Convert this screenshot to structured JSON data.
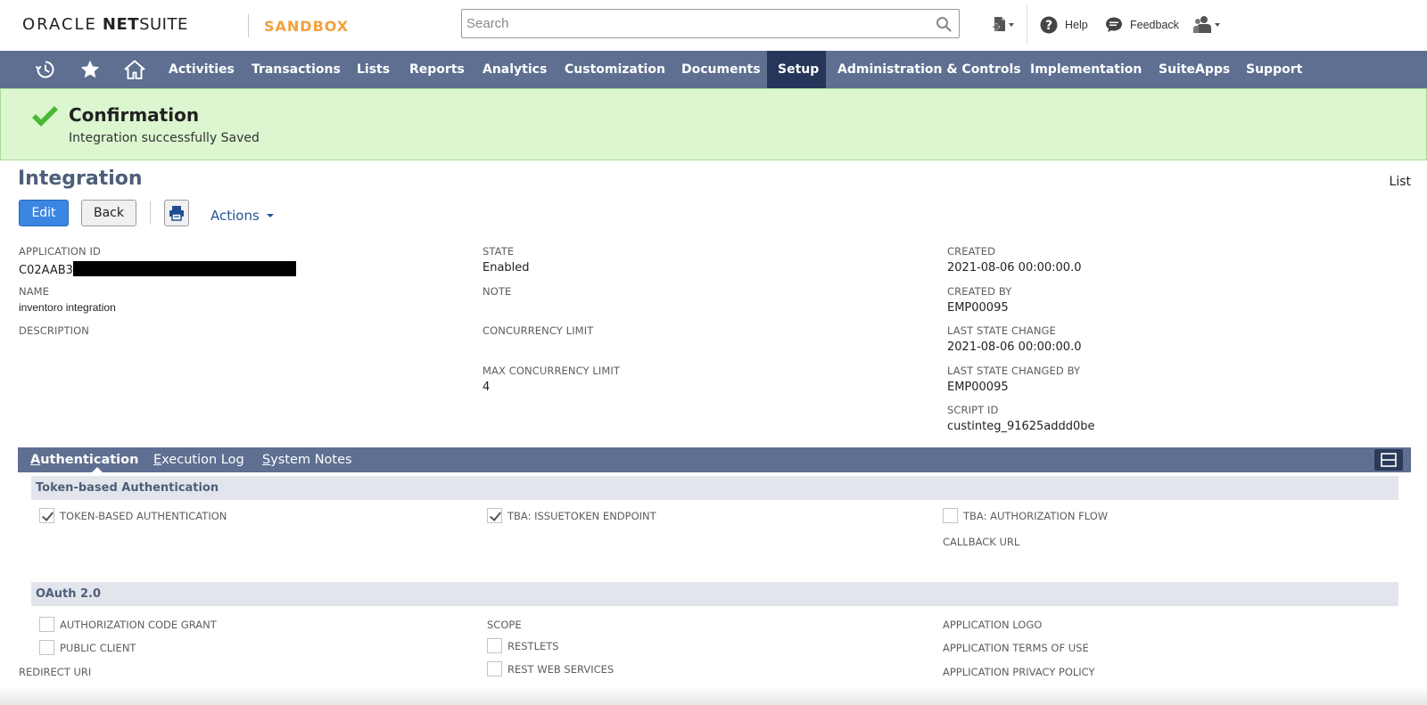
{
  "header": {
    "logo_oracle": "ORACLE",
    "logo_net": "NET",
    "logo_suite": "SUITE",
    "environment": "SANDBOX",
    "search_placeholder": "Search",
    "help_label": "Help",
    "feedback_label": "Feedback"
  },
  "nav": {
    "items": [
      "Activities",
      "Transactions",
      "Lists",
      "Reports",
      "Analytics",
      "Customization",
      "Documents",
      "Setup",
      "Administration & Controls",
      "Implementation",
      "SuiteApps",
      "Support"
    ],
    "active": "Setup",
    "icons": [
      "recent-records-icon",
      "star-icon",
      "home-icon"
    ]
  },
  "confirmation": {
    "title": "Confirmation",
    "message": "Integration successfully Saved",
    "color": "#dcf6cf"
  },
  "page": {
    "title": "Integration",
    "list_link": "List",
    "edit_label": "Edit",
    "back_label": "Back",
    "actions_label": "Actions"
  },
  "fields": {
    "application_id_label": "APPLICATION ID",
    "application_id_value": "C02AAB3",
    "name_label": "NAME",
    "name_value": "inventoro integration",
    "description_label": "DESCRIPTION",
    "state_label": "STATE",
    "state_value": "Enabled",
    "note_label": "NOTE",
    "concurrency_label": "CONCURRENCY LIMIT",
    "max_concurrency_label": "MAX CONCURRENCY LIMIT",
    "max_concurrency_value": "4",
    "created_label": "CREATED",
    "created_value": "2021-08-06 00:00:00.0",
    "created_by_label": "CREATED BY",
    "created_by_value": "EMP00095",
    "last_state_change_label": "LAST STATE CHANGE",
    "last_state_change_value": "2021-08-06 00:00:00.0",
    "last_state_changed_by_label": "LAST STATE CHANGED BY",
    "last_state_changed_by_value": "EMP00095",
    "script_id_label": "SCRIPT ID",
    "script_id_value": "custinteg_91625addd0be"
  },
  "subtabs": {
    "authentication": {
      "first": "A",
      "rest": "uthentication"
    },
    "execution_log": {
      "first": "E",
      "rest": "xecution Log"
    },
    "system_notes": {
      "first": "S",
      "rest": "ystem Notes"
    }
  },
  "tba": {
    "heading": "Token-based Authentication",
    "token_based_auth": {
      "label": "TOKEN-BASED AUTHENTICATION",
      "checked": true
    },
    "issuetoken": {
      "label": "TBA: ISSUETOKEN ENDPOINT",
      "checked": true
    },
    "auth_flow": {
      "label": "TBA: AUTHORIZATION FLOW",
      "checked": false
    },
    "callback_url_label": "CALLBACK URL"
  },
  "oauth": {
    "heading": "OAuth 2.0",
    "auth_code_grant": {
      "label": "AUTHORIZATION CODE GRANT",
      "checked": false
    },
    "public_client": {
      "label": "PUBLIC CLIENT",
      "checked": false
    },
    "redirect_uri_label": "REDIRECT URI",
    "scope_label": "SCOPE",
    "restlets": {
      "label": "RESTLETS",
      "checked": false
    },
    "rest_web_services": {
      "label": "REST WEB SERVICES",
      "checked": false
    },
    "app_logo_label": "APPLICATION LOGO",
    "terms_label": "APPLICATION TERMS OF USE",
    "privacy_label": "APPLICATION PRIVACY POLICY"
  },
  "colors": {
    "nav_bg": "#5e6f91",
    "nav_active": "#25365a",
    "accent_blue": "#3b86e3",
    "title_color": "#4d5f79",
    "sandbox": "#f2a03d"
  }
}
